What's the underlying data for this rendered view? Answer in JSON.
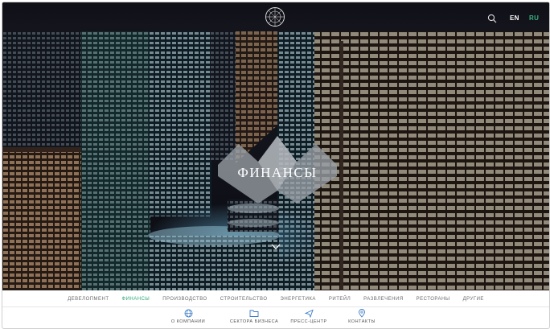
{
  "header": {
    "languages": [
      "EN",
      "RU"
    ],
    "active_language": "RU",
    "accent_color": "#39b37f"
  },
  "hero": {
    "title": "ФИНАНСЫ"
  },
  "sector_nav": [
    {
      "label": "ДЕВЕЛОПМЕНТ",
      "active": false
    },
    {
      "label": "ФИНАНСЫ",
      "active": true
    },
    {
      "label": "ПРОИЗВОДСТВО",
      "active": false
    },
    {
      "label": "СТРОИТЕЛЬСТВО",
      "active": false
    },
    {
      "label": "ЭНЕРГЕТИКА",
      "active": false
    },
    {
      "label": "РИТЕЙЛ",
      "active": false
    },
    {
      "label": "РАЗВЛЕЧЕНИЯ",
      "active": false
    },
    {
      "label": "РЕСТОРАНЫ",
      "active": false
    },
    {
      "label": "ДРУГИЕ",
      "active": false
    }
  ],
  "bottom_nav": [
    {
      "label": "О КОМПАНИИ",
      "icon": "globe-icon"
    },
    {
      "label": "СЕКТОРА БИЗНЕСА",
      "icon": "folder-icon"
    },
    {
      "label": "ПРЕСС-ЦЕНТР",
      "icon": "paper-plane-icon"
    },
    {
      "label": "КОНТАКТЫ",
      "icon": "map-pin-icon"
    }
  ]
}
